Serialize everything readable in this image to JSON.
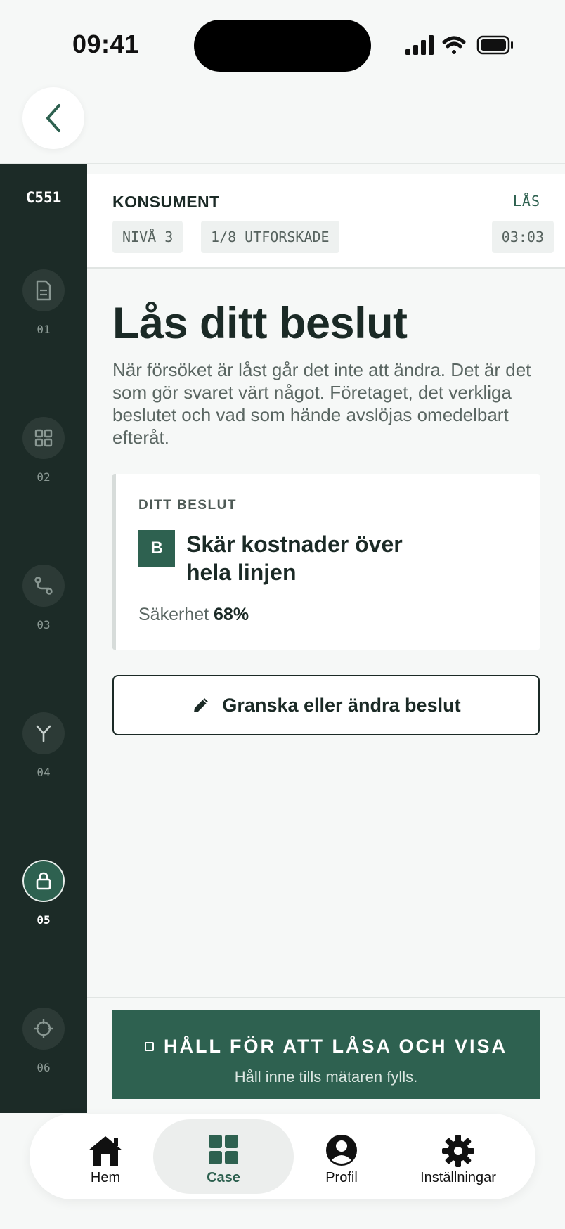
{
  "status_bar": {
    "time": "09:41"
  },
  "case": {
    "code": "C551",
    "title": "KONSUMENT",
    "lock_link": "LÅS",
    "level": "NIVÅ 3",
    "explored": "1/8 UTFORSKADE",
    "timer": "03:03"
  },
  "steps": [
    {
      "num": "01",
      "icon": "document-icon"
    },
    {
      "num": "02",
      "icon": "grid-icon"
    },
    {
      "num": "03",
      "icon": "route-icon"
    },
    {
      "num": "04",
      "icon": "fork-icon"
    },
    {
      "num": "05",
      "icon": "lock-icon",
      "active": true
    },
    {
      "num": "06",
      "icon": "crosshair-icon"
    }
  ],
  "main": {
    "title": "Lås ditt beslut",
    "description": "När försöket är låst går det inte att ändra. Det är det som gör svaret värt något. Företaget, det verkliga beslutet och vad som hände avslöjas omedelbart efteråt."
  },
  "decision": {
    "label": "DITT BESLUT",
    "option_letter": "B",
    "option_text": "Skär kostnader över hela linjen",
    "confidence_label": "Säkerhet",
    "confidence_value": "68%"
  },
  "review_button": {
    "label": "Granska eller ändra beslut",
    "icon": "pencil-icon"
  },
  "hold_button": {
    "title": "HÅLL FÖR ATT LÅSA OCH VISA",
    "subtitle": "Håll inne tills mätaren fylls."
  },
  "tabs": [
    {
      "label": "Hem",
      "icon": "home-icon"
    },
    {
      "label": "Case",
      "icon": "grid-icon",
      "active": true
    },
    {
      "label": "Profil",
      "icon": "profile-icon"
    },
    {
      "label": "Inställningar",
      "icon": "gear-icon"
    }
  ],
  "colors": {
    "accent": "#2e6150",
    "rail": "#1c2b27",
    "text": "#1b2a26"
  }
}
